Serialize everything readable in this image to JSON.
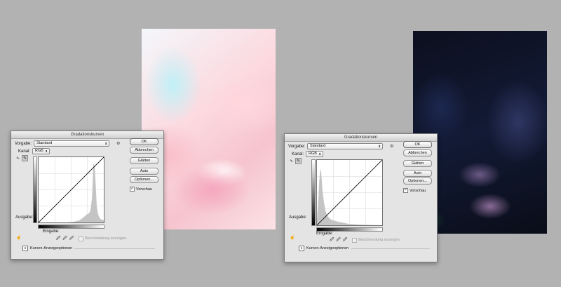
{
  "dialogs": [
    {
      "title": "Gradationskurven",
      "preset_label": "Vorgabe:",
      "preset_value": "Standard",
      "channel_label": "Kanal:",
      "channel_value": "RGB",
      "output_label": "Ausgabe:",
      "input_label": "Eingabe:",
      "show_clipping_label": "Beschneidung anzeigen",
      "curve_options_label": "Kurven-Anzeigeoptionen",
      "buttons": [
        "OK",
        "Abbrechen",
        "Glätten",
        "Auto",
        "Optionen..."
      ],
      "preview_label": "Vorschau",
      "preview_checked": true,
      "histogram_position": "right"
    },
    {
      "title": "Gradationskurven",
      "preset_label": "Vorgabe:",
      "preset_value": "Standard",
      "channel_label": "Kanal:",
      "channel_value": "RGB",
      "output_label": "Ausgabe:",
      "input_label": "Eingabe:",
      "show_clipping_label": "Beschneidung anzeigen",
      "curve_options_label": "Kurven-Anzeigeoptionen",
      "buttons": [
        "OK",
        "Abbrechen",
        "Glätten",
        "Auto",
        "Optionen..."
      ],
      "preview_label": "Vorschau",
      "preview_checked": true,
      "histogram_position": "left"
    }
  ],
  "icons": {
    "gear": "gear-icon",
    "curve_tool": "curve-tool-icon",
    "pencil_tool": "pencil-tool-icon",
    "eyedroppers": [
      "black-eyedropper-icon",
      "gray-eyedropper-icon",
      "white-eyedropper-icon"
    ],
    "hand_tool": "hand-adjust-icon",
    "disclosure": "disclosure-triangle-icon"
  },
  "colors": {
    "background": "#b2b2b2",
    "dialog_bg": "#e4e4e4",
    "histogram": "#c4c4c4",
    "curve": "#000000"
  }
}
